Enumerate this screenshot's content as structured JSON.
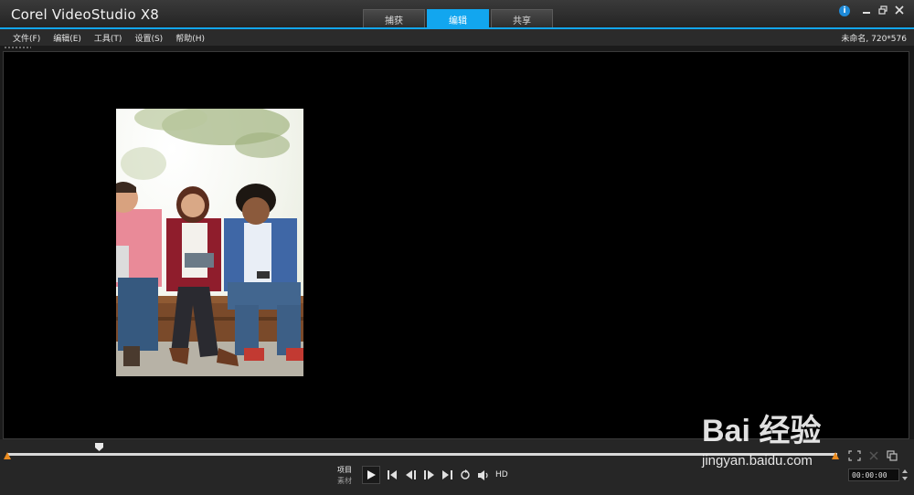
{
  "app": {
    "title": "Corel  VideoStudio X8"
  },
  "tabs": [
    {
      "label": "捕获",
      "active": false
    },
    {
      "label": "编辑",
      "active": true
    },
    {
      "label": "共享",
      "active": false
    }
  ],
  "menu": [
    "文件(F)",
    "编辑(E)",
    "工具(T)",
    "设置(S)",
    "帮助(H)"
  ],
  "project_info": "未命名, 720*576",
  "player": {
    "mode_project": "项目",
    "mode_clip": "素材",
    "hd_label": "HD",
    "timecode": "00:00:00"
  },
  "watermark": {
    "brand": "Bai  经验",
    "url": "jingyan.baidu.com"
  },
  "colors": {
    "accent": "#12a6ef",
    "preview_bg": "#000000",
    "marker": "#e98a1f"
  },
  "icons": [
    "info-icon",
    "minimize-icon",
    "restore-icon",
    "close-icon",
    "play-icon",
    "home-icon",
    "prev-frame-icon",
    "next-frame-icon",
    "end-icon",
    "repeat-icon",
    "volume-icon",
    "crop-icon",
    "expand-icon",
    "duplicate-icon"
  ]
}
